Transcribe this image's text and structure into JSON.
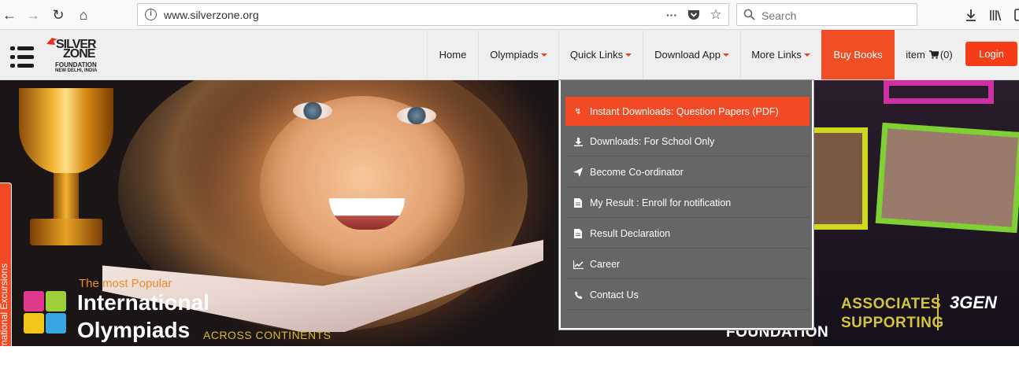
{
  "browser": {
    "url": "www.silverzone.org",
    "search_placeholder": "Search",
    "icons": [
      "back-icon",
      "forward-icon",
      "reload-icon",
      "home-icon",
      "info-icon",
      "more-icon",
      "pocket-icon",
      "bookmark-star-icon",
      "search-icon",
      "download-icon",
      "library-icon",
      "sidebar-icon"
    ]
  },
  "site": {
    "logo": {
      "line1": "SILVER",
      "line2": "ZONE",
      "line3": "FOUNDATION",
      "line4": "NEW DELHI, INDIA"
    },
    "nav": {
      "home": "Home",
      "olympiads": "Olympiads",
      "quick_links": "Quick Links",
      "download_app": "Download App",
      "more_links": "More Links",
      "buy_books": "Buy Books",
      "cart_label": "item",
      "cart_count": "(0)",
      "login": "Login"
    },
    "accent_color": "#f24a24"
  },
  "banner": {
    "side_tab": "International Excursions",
    "tagline_small": "The most Popular",
    "tagline_line1": "International",
    "tagline_line2": "Olympiads",
    "tagline_suffix": "ACROSS CONTINENTS",
    "foundation_text": "FOUNDATION",
    "associates_line1": "ASSOCIATES",
    "associates_line2": "SUPPORTING",
    "partner_logo": "3GEN"
  },
  "dropdown": {
    "items": [
      {
        "label": "Instant Downloads: Question Papers (PDF)",
        "icon": "download-file-icon",
        "active": true
      },
      {
        "label": "Downloads: For School Only",
        "icon": "download-icon",
        "active": false
      },
      {
        "label": "Become Co-ordinator",
        "icon": "paper-plane-icon",
        "active": false
      },
      {
        "label": "My Result : Enroll for notification",
        "icon": "document-icon",
        "active": false
      },
      {
        "label": "Result Declaration",
        "icon": "document-icon",
        "active": false
      },
      {
        "label": "Career",
        "icon": "line-chart-icon",
        "active": false
      },
      {
        "label": "Contact Us",
        "icon": "phone-icon",
        "active": false
      }
    ]
  }
}
